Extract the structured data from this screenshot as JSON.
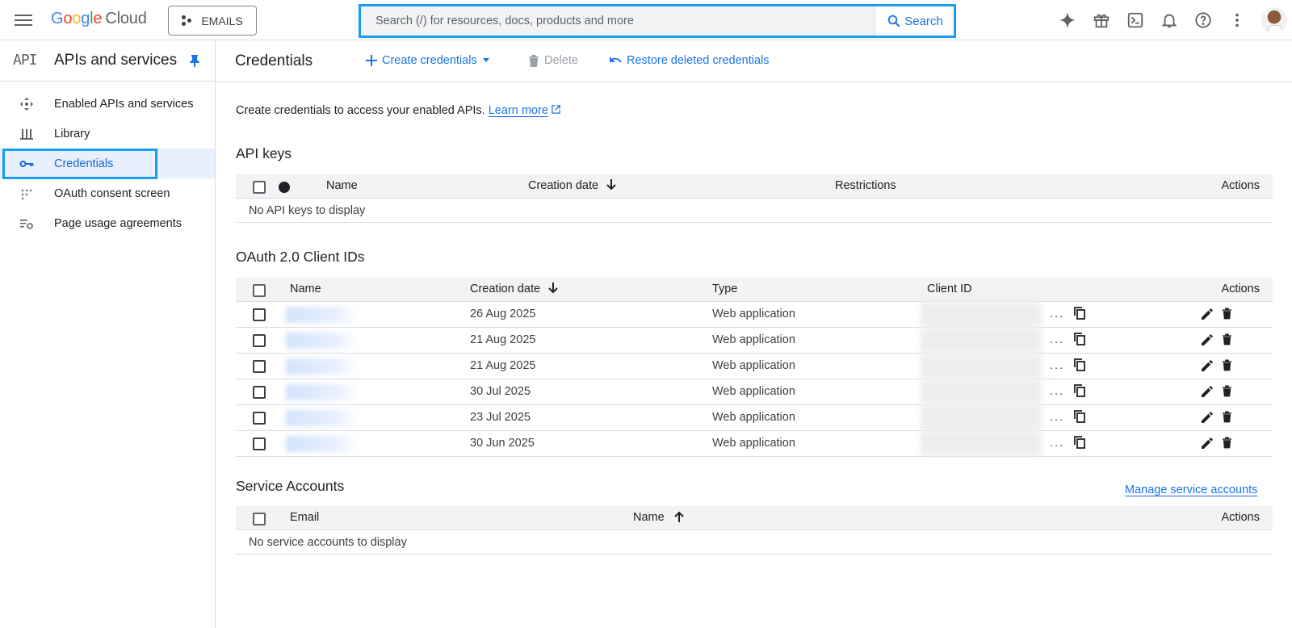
{
  "topbar": {
    "logo_letters": [
      "G",
      "o",
      "o",
      "g",
      "l",
      "e"
    ],
    "logo_cloud": "Cloud",
    "project_label": "EMAILS",
    "search_placeholder": "Search (/) for resources, docs, products and more",
    "search_button": "Search",
    "icons": [
      "sparkle-icon",
      "gift-icon",
      "terminal-icon",
      "bell-icon",
      "help-icon",
      "more-vert-icon"
    ]
  },
  "sidebar": {
    "logo_text": "API",
    "title": "APIs and services",
    "items": [
      {
        "label": "Enabled APIs and services",
        "icon": "move-icon"
      },
      {
        "label": "Library",
        "icon": "library-icon"
      },
      {
        "label": "Credentials",
        "icon": "key-icon",
        "active": true
      },
      {
        "label": "OAuth consent screen",
        "icon": "oauth-icon"
      },
      {
        "label": "Page usage agreements",
        "icon": "settings-list-icon"
      }
    ],
    "collapse_label": "<I"
  },
  "main": {
    "title": "Credentials",
    "actions": {
      "create": "Create credentials",
      "delete": "Delete",
      "restore": "Restore deleted credentials"
    },
    "intro_text": "Create credentials to access your enabled APIs.",
    "learn_more": "Learn more"
  },
  "api_keys": {
    "title": "API keys",
    "columns": {
      "name": "Name",
      "creation_date": "Creation date",
      "restrictions": "Restrictions",
      "actions": "Actions"
    },
    "empty_text": "No API keys to display"
  },
  "oauth": {
    "title": "OAuth 2.0 Client IDs",
    "columns": {
      "name": "Name",
      "creation_date": "Creation date",
      "type": "Type",
      "client_id": "Client ID",
      "actions": "Actions"
    },
    "rows": [
      {
        "date": "26 Aug 2025",
        "type": "Web application"
      },
      {
        "date": "21 Aug 2025",
        "type": "Web application"
      },
      {
        "date": "21 Aug 2025",
        "type": "Web application"
      },
      {
        "date": "30 Jul 2025",
        "type": "Web application"
      },
      {
        "date": "23 Jul 2025",
        "type": "Web application"
      },
      {
        "date": "30 Jun 2025",
        "type": "Web application"
      }
    ],
    "ellipsis": "..."
  },
  "service_accounts": {
    "title": "Service Accounts",
    "manage_link": "Manage service accounts",
    "columns": {
      "email": "Email",
      "name": "Name",
      "actions": "Actions"
    },
    "empty_text": "No service accounts to display"
  },
  "colors": {
    "accent": "#1a73e8",
    "highlight": "#1a9cf0",
    "active_bg": "#e8f0fe"
  }
}
